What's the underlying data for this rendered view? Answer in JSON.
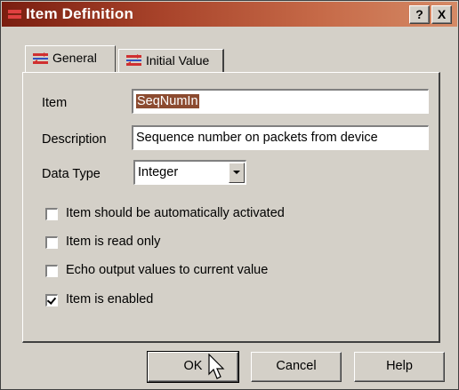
{
  "window": {
    "title": "Item Definition",
    "help_label": "?",
    "close_label": "X",
    "icon": "item-definition-icon"
  },
  "tabs": [
    {
      "label": "General",
      "icon": "general-tab-icon",
      "active": true
    },
    {
      "label": "Initial Value",
      "icon": "initial-value-tab-icon",
      "active": false
    }
  ],
  "form": {
    "item_label": "Item",
    "item_value": "SeqNumIn",
    "description_label": "Description",
    "description_value": "Sequence number on packets from device",
    "data_type_label": "Data Type",
    "data_type_value": "Integer"
  },
  "checkboxes": [
    {
      "label": "Item should be automatically activated",
      "checked": false
    },
    {
      "label": "Item is read only",
      "checked": false
    },
    {
      "label": "Echo output values to current value",
      "checked": false
    },
    {
      "label": "Item is enabled",
      "checked": true
    }
  ],
  "buttons": {
    "ok": "OK",
    "cancel": "Cancel",
    "help": "Help"
  },
  "colors": {
    "titlebar_start": "#7a1e10",
    "titlebar_end": "#d58a66",
    "selection": "#8c4b30",
    "face": "#d4d0c8"
  }
}
